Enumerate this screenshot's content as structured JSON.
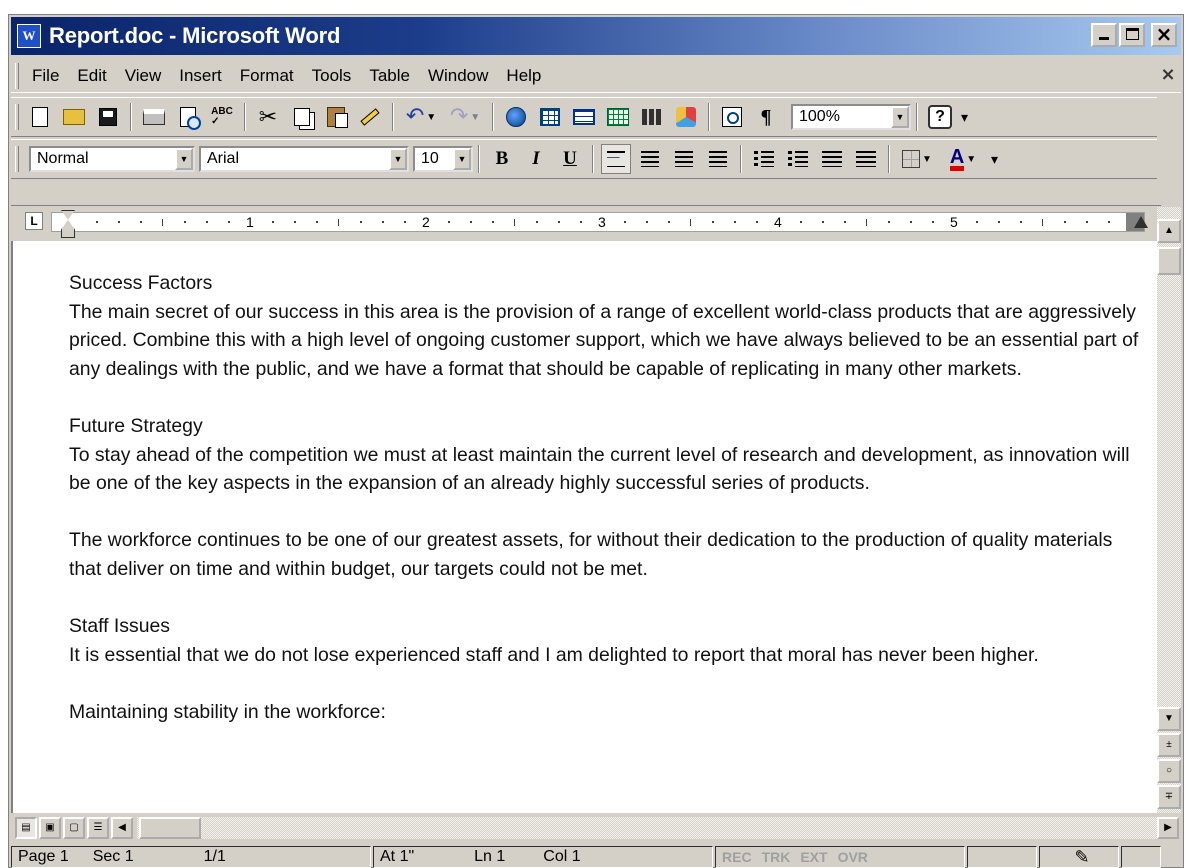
{
  "window": {
    "title": "Report.doc - Microsoft Word",
    "app_icon": "W"
  },
  "menubar": {
    "items": [
      {
        "label": "File",
        "accel": "F"
      },
      {
        "label": "Edit",
        "accel": "E"
      },
      {
        "label": "View",
        "accel": "V"
      },
      {
        "label": "Insert",
        "accel": "I"
      },
      {
        "label": "Format",
        "accel": "o"
      },
      {
        "label": "Tools",
        "accel": "T"
      },
      {
        "label": "Table",
        "accel": "a"
      },
      {
        "label": "Window",
        "accel": "W"
      },
      {
        "label": "Help",
        "accel": "H"
      }
    ]
  },
  "standard_toolbar": {
    "icons": [
      "new-document-icon",
      "open-folder-icon",
      "save-icon",
      "print-icon",
      "print-preview-icon",
      "spelling-grammar-icon",
      "cut-icon",
      "copy-icon",
      "paste-icon",
      "format-painter-icon",
      "undo-icon",
      "redo-icon",
      "insert-hyperlink-icon",
      "tables-borders-icon",
      "insert-table-icon",
      "insert-excel-worksheet-icon",
      "columns-icon",
      "drawing-icon",
      "document-map-icon",
      "show-hide-icon",
      "help-icon"
    ],
    "zoom": "100%",
    "help_glyph": "?"
  },
  "formatting_toolbar": {
    "style": "Normal",
    "font": "Arial",
    "size": "10",
    "bold": "B",
    "italic": "I",
    "underline": "U",
    "font_color_glyph": "A",
    "font_color": "#e00000",
    "icons": [
      "align-left-icon",
      "center-icon",
      "align-right-icon",
      "justify-icon",
      "numbering-icon",
      "bullets-icon",
      "decrease-indent-icon",
      "increase-indent-icon",
      "borders-icon",
      "font-color-icon"
    ]
  },
  "ruler": {
    "tab_marker": "L",
    "numbers": [
      "1",
      "2",
      "3",
      "4",
      "5"
    ]
  },
  "document": {
    "paragraphs": [
      {
        "heading": "Success Factors",
        "text": "The main secret of our success in this area is the provision of a range of excellent world-class products that are aggressively priced. Combine this with a high level of ongoing customer support, which we have always believed to be an essential part of any dealings with the public, and we have a format that should be capable of replicating in many other markets."
      },
      {
        "heading": "Future Strategy",
        "text": "To stay ahead of the competition we must at least maintain the current level of research and development, as innovation will be one of the key aspects in the expansion of an already highly successful series of products."
      },
      {
        "heading": "",
        "text": "The workforce continues to be one of our greatest assets, for without their dedication to the production of quality materials that deliver on time and within budget, our targets could not be met."
      },
      {
        "heading": "Staff Issues",
        "text": "It is essential that we do not lose experienced staff and I am delighted to report that moral has never been higher."
      },
      {
        "heading": "",
        "text": "Maintaining stability in the workforce:"
      }
    ]
  },
  "statusbar": {
    "page": "Page 1",
    "section": "Sec 1",
    "pages": "1/1",
    "at": "At 1\"",
    "line": "Ln 1",
    "col": "Col 1",
    "modes": [
      "REC",
      "TRK",
      "EXT",
      "OVR"
    ]
  },
  "colors": {
    "titlebar_start": "#0a246a",
    "titlebar_end": "#a6caf0",
    "chrome": "#d4d0c8"
  }
}
